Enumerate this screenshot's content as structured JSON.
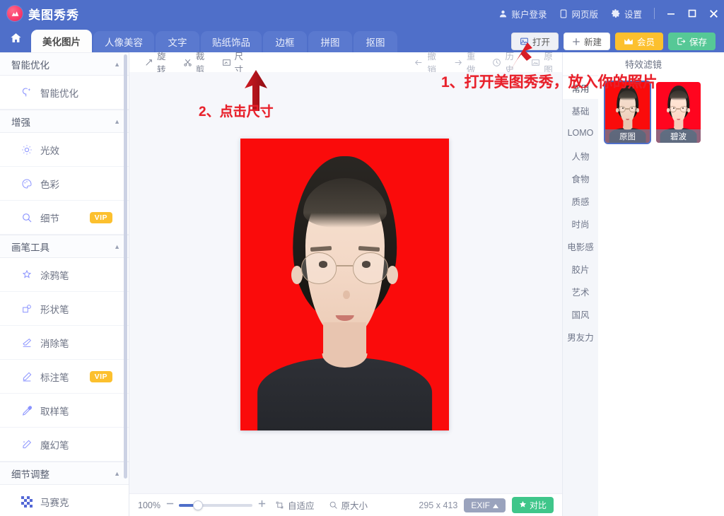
{
  "app": {
    "name": "美图秀秀",
    "logo_icon": "meitu-logo-icon",
    "brand_color": "#4f6fc9"
  },
  "titlebar": {
    "account_label": "账户登录",
    "account_icon": "user-icon",
    "web_label": "网页版",
    "web_icon": "phone-icon",
    "settings_label": "设置",
    "settings_icon": "gear-icon",
    "minimize_icon": "minimize-icon",
    "maximize_icon": "maximize-icon",
    "close_icon": "close-icon"
  },
  "tabs": {
    "home_icon": "home-icon",
    "items": [
      {
        "label": "美化图片",
        "active": true
      },
      {
        "label": "人像美容",
        "active": false
      },
      {
        "label": "文字",
        "active": false
      },
      {
        "label": "贴纸饰品",
        "active": false
      },
      {
        "label": "边框",
        "active": false
      },
      {
        "label": "拼图",
        "active": false
      },
      {
        "label": "抠图",
        "active": false
      }
    ],
    "actions": [
      {
        "label": "打开",
        "icon": "image-open-icon",
        "style": "open"
      },
      {
        "label": "新建",
        "icon": "plus-icon",
        "style": "new"
      },
      {
        "label": "会员",
        "icon": "crown-icon",
        "style": "vip"
      },
      {
        "label": "保存",
        "icon": "export-icon",
        "style": "save"
      }
    ]
  },
  "sidebar": {
    "groups": [
      {
        "title": "智能优化",
        "collapse_icon": "chevron-up-icon",
        "items": [
          {
            "label": "智能优化",
            "icon": "magic-wand-icon",
            "badge": ""
          }
        ]
      },
      {
        "title": "增强",
        "collapse_icon": "chevron-up-icon",
        "items": [
          {
            "label": "光效",
            "icon": "sun-icon",
            "badge": ""
          },
          {
            "label": "色彩",
            "icon": "palette-icon",
            "badge": ""
          },
          {
            "label": "细节",
            "icon": "magnifier-icon",
            "badge": "VIP"
          }
        ]
      },
      {
        "title": "画笔工具",
        "collapse_icon": "chevron-up-icon",
        "items": [
          {
            "label": "涂鸦笔",
            "icon": "doodle-pen-icon",
            "badge": ""
          },
          {
            "label": "形状笔",
            "icon": "shape-pen-icon",
            "badge": ""
          },
          {
            "label": "消除笔",
            "icon": "eraser-pen-icon",
            "badge": ""
          },
          {
            "label": "标注笔",
            "icon": "marker-pen-icon",
            "badge": "VIP"
          },
          {
            "label": "取样笔",
            "icon": "eyedropper-icon",
            "badge": ""
          },
          {
            "label": "魔幻笔",
            "icon": "magic-pen-icon",
            "badge": ""
          }
        ]
      },
      {
        "title": "细节调整",
        "collapse_icon": "chevron-up-icon",
        "items": [
          {
            "label": "马赛克",
            "icon": "mosaic-icon",
            "badge": ""
          }
        ]
      }
    ]
  },
  "worktoolbar": {
    "left": [
      {
        "label": "旋转",
        "icon": "rotate-icon",
        "dim": false
      },
      {
        "label": "裁剪",
        "icon": "crop-scissors-icon",
        "dim": false
      },
      {
        "label": "尺寸",
        "icon": "resize-icon",
        "dim": false
      }
    ],
    "right": [
      {
        "label": "撤销",
        "icon": "undo-arrow-icon",
        "dim": true
      },
      {
        "label": "重做",
        "icon": "redo-arrow-icon",
        "dim": true
      },
      {
        "label": "历史",
        "icon": "clock-icon",
        "dim": true
      },
      {
        "label": "原图",
        "icon": "original-image-icon",
        "dim": true
      }
    ]
  },
  "bottombar": {
    "zoom_percent": "100%",
    "zoom_out_icon": "minus-icon",
    "zoom_in_icon": "plus-icon",
    "fit_label": "自适应",
    "fit_icon": "fit-screen-icon",
    "actual_label": "原大小",
    "actual_icon": "actual-size-icon",
    "dimensions": "295 x 413",
    "exif_label": "EXIF",
    "exif_caret_icon": "caret-up-icon",
    "compare_label": "对比",
    "compare_icon": "star-icon"
  },
  "rightpanel": {
    "title": "特效滤镜",
    "categories": [
      {
        "label": "常用",
        "active": true
      },
      {
        "label": "基础",
        "active": false
      },
      {
        "label": "LOMO",
        "active": false
      },
      {
        "label": "人物",
        "active": false
      },
      {
        "label": "食物",
        "active": false
      },
      {
        "label": "质感",
        "active": false
      },
      {
        "label": "时尚",
        "active": false
      },
      {
        "label": "电影感",
        "active": false
      },
      {
        "label": "胶片",
        "active": false
      },
      {
        "label": "艺术",
        "active": false
      },
      {
        "label": "国风",
        "active": false
      },
      {
        "label": "男友力",
        "active": false
      }
    ],
    "filters": [
      {
        "label": "原图",
        "selected": true
      },
      {
        "label": "碧波",
        "selected": false
      }
    ]
  },
  "annotations": [
    {
      "id": "anno1",
      "text": "1、打开美图秀秀，放入你的照片",
      "color": "#e8202a"
    },
    {
      "id": "anno2",
      "text": "2、点击尺寸",
      "color": "#e8202a"
    }
  ],
  "canvas": {
    "photo_alt": "id-photo-red-background"
  }
}
